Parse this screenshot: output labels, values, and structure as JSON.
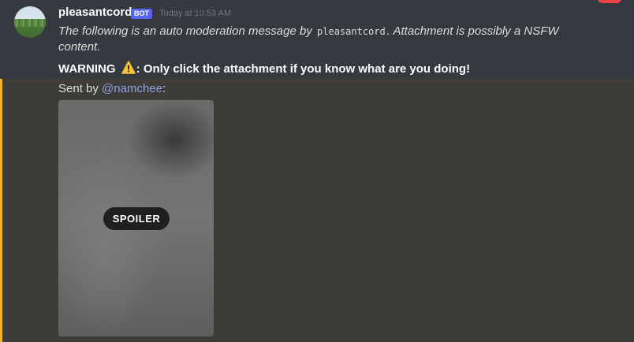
{
  "message": {
    "author": "pleasantcord",
    "bot_tag": "BOT",
    "timestamp": "Today at 10:53 AM",
    "line1_prefix": "The following is an auto moderation message by ",
    "line1_code": "pleasantcord",
    "line1_suffix": ". Attachment is possibly a NSFW content.",
    "warning_label": "WARNING",
    "warning_text": ": Only click the attachment if you know what are you doing!",
    "warning_icon": "warning-icon",
    "sent_by_label": "Sent by ",
    "sent_by_mention": "@namchee",
    "sent_by_suffix": ":"
  },
  "attachment": {
    "spoiler_label": "SPOILER"
  },
  "colors": {
    "accent_bar": "#f0b232",
    "bot_tag": "#5865f2",
    "mention": "#8ea1e1"
  }
}
